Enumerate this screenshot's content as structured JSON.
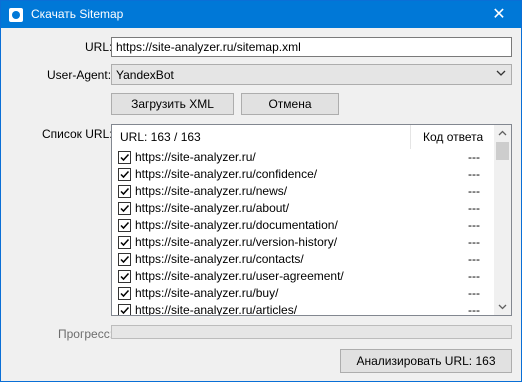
{
  "window": {
    "title": "Скачать Sitemap",
    "close_glyph": "✕",
    "app_icon": "sitemap-app-icon"
  },
  "form": {
    "url_label": "URL:",
    "url_value": "https://site-analyzer.ru/sitemap.xml",
    "user_agent_label": "User-Agent:",
    "user_agent_value": "YandexBot",
    "load_button": "Загрузить XML",
    "cancel_button": "Отмена",
    "list_label": "Список URL:",
    "progress_label": "Прогресс:",
    "progress_value": 0,
    "analyze_button": "Анализировать URL: 163"
  },
  "list": {
    "header_url": "URL: 163 / 163",
    "header_code": "Код ответа",
    "rows": [
      {
        "url": "https://site-analyzer.ru/",
        "code": "---",
        "checked": true
      },
      {
        "url": "https://site-analyzer.ru/confidence/",
        "code": "---",
        "checked": true
      },
      {
        "url": "https://site-analyzer.ru/news/",
        "code": "---",
        "checked": true
      },
      {
        "url": "https://site-analyzer.ru/about/",
        "code": "---",
        "checked": true
      },
      {
        "url": "https://site-analyzer.ru/documentation/",
        "code": "---",
        "checked": true
      },
      {
        "url": "https://site-analyzer.ru/version-history/",
        "code": "---",
        "checked": true
      },
      {
        "url": "https://site-analyzer.ru/contacts/",
        "code": "---",
        "checked": true
      },
      {
        "url": "https://site-analyzer.ru/user-agreement/",
        "code": "---",
        "checked": true
      },
      {
        "url": "https://site-analyzer.ru/buy/",
        "code": "---",
        "checked": true
      },
      {
        "url": "https://site-analyzer.ru/articles/",
        "code": "---",
        "checked": true
      }
    ]
  },
  "colors": {
    "titlebar": "#0078d7",
    "progress_fill": "#06b025"
  }
}
